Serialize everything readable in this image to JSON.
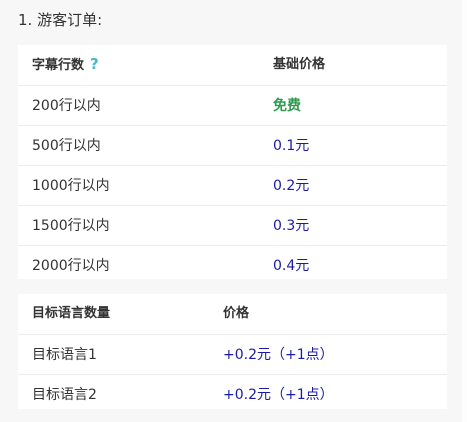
{
  "heading": "1. 游客订单:",
  "table1": {
    "header": {
      "col1": "字幕行数",
      "col2": "基础价格"
    },
    "rows": [
      {
        "lines": "200行以内",
        "price": "免费"
      },
      {
        "lines": "500行以内",
        "price": "0.1元"
      },
      {
        "lines": "1000行以内",
        "price": "0.2元"
      },
      {
        "lines": "1500行以内",
        "price": "0.3元"
      },
      {
        "lines": "2000行以内",
        "price": "0.4元"
      }
    ]
  },
  "table2": {
    "header": {
      "col1": "目标语言数量",
      "col2": "价格"
    },
    "rows": [
      {
        "count": "目标语言1",
        "price": "+0.2元（+1点）"
      },
      {
        "count": "目标语言2",
        "price": "+0.2元（+1点）"
      }
    ]
  },
  "colors": {
    "price_blue": "#1a1aa6",
    "free_green": "#2e9a4e",
    "help_icon": "#4db6c8"
  },
  "icons": {
    "help": "question-mark-icon"
  }
}
